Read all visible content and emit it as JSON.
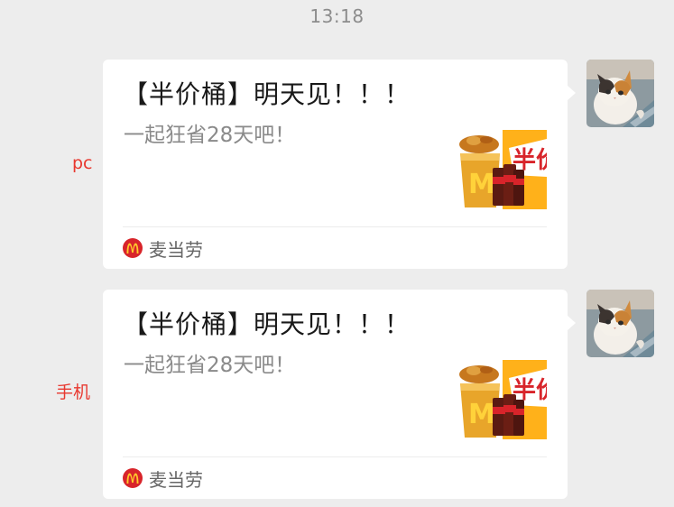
{
  "timestamp": "13:18",
  "messages": [
    {
      "label": "pc",
      "card": {
        "title": "【半价桶】明天见！！！",
        "description": "一起狂省28天吧！",
        "thumbnail_icon": "mcdonalds-bucket-promo-image",
        "source_icon": "mcdonalds-logo-icon",
        "source": "麦当劳"
      }
    },
    {
      "label": "手机",
      "card": {
        "title": "【半价桶】明天见！！！",
        "description": "一起狂省28天吧！",
        "thumbnail_icon": "mcdonalds-bucket-promo-image",
        "source_icon": "mcdonalds-logo-icon",
        "source": "麦当劳"
      }
    }
  ],
  "colors": {
    "background": "#ededed",
    "card": "#ffffff",
    "label": "#e8382f",
    "mcd_red": "#d8242a",
    "mcd_yellow": "#ffc72c"
  }
}
